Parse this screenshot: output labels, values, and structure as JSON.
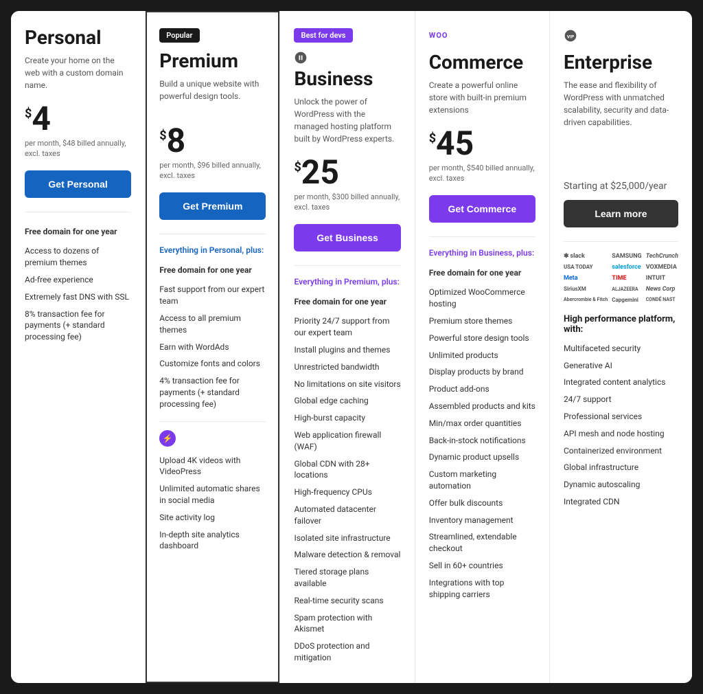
{
  "plans": [
    {
      "id": "personal",
      "badge": null,
      "logo": null,
      "title": "Personal",
      "description": "Create your home on the web with a custom domain name.",
      "price": "4",
      "price_note": "per month, $48 billed annually, excl. taxes",
      "cta": "Get Personal",
      "cta_style": "btn-blue",
      "features_header": null,
      "features_header_style": "blue",
      "starting_price": null,
      "features": [
        {
          "text": "Free domain for one year",
          "bold": true
        },
        {
          "text": "Access to dozens of premium themes",
          "bold": false
        },
        {
          "text": "Ad-free experience",
          "bold": false
        },
        {
          "text": "Extremely fast DNS with SSL",
          "bold": false
        },
        {
          "text": "8% transaction fee for payments (+ standard processing fee)",
          "bold": false
        }
      ],
      "extra_section": null
    },
    {
      "id": "premium",
      "badge": "Popular",
      "badge_style": "dark",
      "logo": null,
      "title": "Premium",
      "description": "Build a unique website with powerful design tools.",
      "price": "8",
      "price_note": "per month, $96 billed annually, excl. taxes",
      "cta": "Get Premium",
      "cta_style": "btn-blue",
      "features_header": "Everything in Personal, plus:",
      "features_header_style": "blue",
      "starting_price": null,
      "features": [
        {
          "text": "Free domain for one year",
          "bold": true
        },
        {
          "text": "Fast support from our expert team",
          "bold": false
        },
        {
          "text": "Access to all premium themes",
          "bold": false
        },
        {
          "text": "Earn with WordAds",
          "bold": false
        },
        {
          "text": "Customize fonts and colors",
          "bold": false
        },
        {
          "text": "4% transaction fee for payments (+ standard processing fee)",
          "bold": false
        }
      ],
      "extra_section": {
        "icon": "⚡",
        "items": [
          "Upload 4K videos with VideoPress",
          "Unlimited automatic shares in social media",
          "Site activity log",
          "In-depth site analytics dashboard"
        ]
      }
    },
    {
      "id": "business",
      "badge": "Best for devs",
      "badge_style": "purple",
      "logo": "wp",
      "title": "Business",
      "description": "Unlock the power of WordPress with the managed hosting platform built by WordPress experts.",
      "price": "25",
      "price_note": "per month, $300 billed annually, excl. taxes",
      "cta": "Get Business",
      "cta_style": "btn-purple",
      "features_header": "Everything in Premium, plus:",
      "features_header_style": "purple",
      "starting_price": null,
      "features": [
        {
          "text": "Free domain for one year",
          "bold": true
        },
        {
          "text": "Priority 24/7 support from our expert team",
          "bold": false
        },
        {
          "text": "Install plugins and themes",
          "bold": false
        },
        {
          "text": "Unrestricted bandwidth",
          "bold": false
        },
        {
          "text": "No limitations on site visitors",
          "bold": false
        },
        {
          "text": "Global edge caching",
          "bold": false
        },
        {
          "text": "High-burst capacity",
          "bold": false
        },
        {
          "text": "Web application firewall (WAF)",
          "bold": false
        },
        {
          "text": "Global CDN with 28+ locations",
          "bold": false
        },
        {
          "text": "High-frequency CPUs",
          "bold": false
        },
        {
          "text": "Automated datacenter failover",
          "bold": false
        },
        {
          "text": "Isolated site infrastructure",
          "bold": false
        },
        {
          "text": "Malware detection & removal",
          "bold": false
        },
        {
          "text": "Tiered storage plans available",
          "bold": false
        },
        {
          "text": "Real-time security scans",
          "bold": false
        },
        {
          "text": "Spam protection with Akismet",
          "bold": false
        },
        {
          "text": "DDoS protection and mitigation",
          "bold": false
        }
      ],
      "extra_section": null
    },
    {
      "id": "commerce",
      "badge": null,
      "logo": "woo",
      "title": "Commerce",
      "description": "Create a powerful online store with built-in premium extensions",
      "price": "45",
      "price_note": "per month, $540 billed annually, excl. taxes",
      "cta": "Get Commerce",
      "cta_style": "btn-purple",
      "features_header": "Everything in Business, plus:",
      "features_header_style": "purple",
      "starting_price": null,
      "features": [
        {
          "text": "Free domain for one year",
          "bold": true
        },
        {
          "text": "Optimized WooCommerce hosting",
          "bold": false
        },
        {
          "text": "Premium store themes",
          "bold": false
        },
        {
          "text": "Powerful store design tools",
          "bold": false
        },
        {
          "text": "Unlimited products",
          "bold": false
        },
        {
          "text": "Display products by brand",
          "bold": false
        },
        {
          "text": "Product add-ons",
          "bold": false
        },
        {
          "text": "Assembled products and kits",
          "bold": false
        },
        {
          "text": "Min/max order quantities",
          "bold": false
        },
        {
          "text": "Back-in-stock notifications",
          "bold": false
        },
        {
          "text": "Dynamic product upsells",
          "bold": false
        },
        {
          "text": "Custom marketing automation",
          "bold": false
        },
        {
          "text": "Offer bulk discounts",
          "bold": false
        },
        {
          "text": "Inventory management",
          "bold": false
        },
        {
          "text": "Streamlined, extendable checkout",
          "bold": false
        },
        {
          "text": "Sell in 60+ countries",
          "bold": false
        },
        {
          "text": "Integrations with top shipping carriers",
          "bold": false
        }
      ],
      "extra_section": null
    },
    {
      "id": "enterprise",
      "badge": null,
      "logo": "vip",
      "title": "Enterprise",
      "description": "The ease and flexibility of WordPress with unmatched scalability, security and data-driven capabilities.",
      "price": null,
      "price_note": null,
      "cta": "Learn more",
      "cta_style": "btn-dark",
      "features_header": null,
      "starting_price": "Starting at $25,000/year",
      "logos": [
        {
          "name": "slack",
          "label": "slack"
        },
        {
          "name": "samsung",
          "label": "SAMSUNG"
        },
        {
          "name": "tc",
          "label": "TechCrunch"
        },
        {
          "name": "usatoday",
          "label": "USA TODAY"
        },
        {
          "name": "salesforce",
          "label": "salesforce"
        },
        {
          "name": "voxmedia",
          "label": "VOXMEDIA"
        },
        {
          "name": "meta",
          "label": "Meta"
        },
        {
          "name": "time",
          "label": "TIME"
        },
        {
          "name": "intuit",
          "label": "INTUIT"
        },
        {
          "name": "siriusxm",
          "label": "SiriusXM"
        },
        {
          "name": "aljazeera",
          "label": "ALJAZEERA"
        },
        {
          "name": "newscorp",
          "label": "News Corp"
        },
        {
          "name": "abercrombie",
          "label": "Abercrombie & Fitch"
        },
        {
          "name": "capgemini",
          "label": "Capgemini"
        },
        {
          "name": "condenast",
          "label": "CONDÉ NAST"
        }
      ],
      "high_perf_label": "High performance platform, with:",
      "features": [
        {
          "text": "Multifaceted security",
          "bold": false
        },
        {
          "text": "Generative AI",
          "bold": false
        },
        {
          "text": "Integrated content analytics",
          "bold": false
        },
        {
          "text": "24/7 support",
          "bold": false
        },
        {
          "text": "Professional services",
          "bold": false
        },
        {
          "text": "API mesh and node hosting",
          "bold": false
        },
        {
          "text": "Containerized environment",
          "bold": false
        },
        {
          "text": "Global infrastructure",
          "bold": false
        },
        {
          "text": "Dynamic autoscaling",
          "bold": false
        },
        {
          "text": "Integrated CDN",
          "bold": false
        }
      ]
    }
  ],
  "colors": {
    "blue": "#1565c0",
    "purple": "#7c3aed",
    "dark": "#1a1a1a",
    "text": "#333",
    "muted": "#555"
  }
}
